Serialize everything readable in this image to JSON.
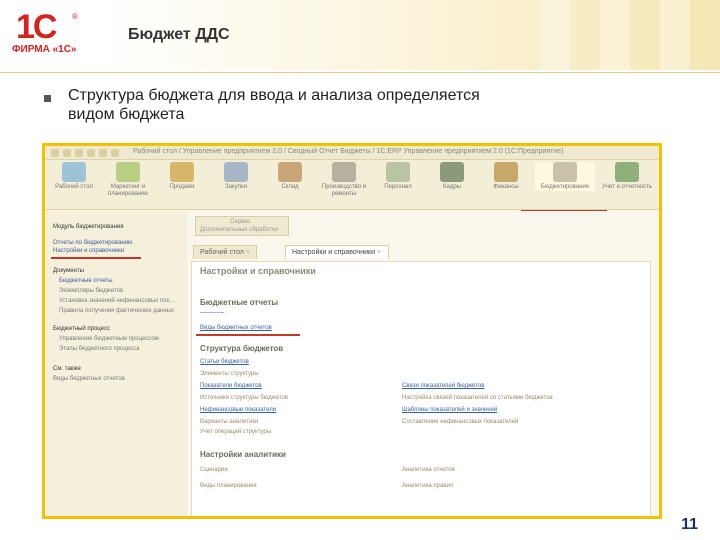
{
  "slide": {
    "logo_mark": "1С",
    "logo_reg": "®",
    "logo_text": "ФИРМА «1С»",
    "title": "Бюджет ДДС",
    "bullet": "Структура бюджета для ввода и анализа определяется видом бюджета",
    "page_number": "11"
  },
  "app": {
    "title": "Рабочий стол / Управление предприятием 2.0 / Сводный Отчет Бюджеты / 1С:ERP Управление предприятием 2.0 (1С:Предприятие)",
    "sections": [
      {
        "label": "Рабочий стол",
        "color": "#9cc3d8"
      },
      {
        "label": "Маркетинг и планирование",
        "color": "#b9cf83"
      },
      {
        "label": "Продажи",
        "color": "#d8b76a"
      },
      {
        "label": "Закупки",
        "color": "#a7b7c8"
      },
      {
        "label": "Склад",
        "color": "#c8a679"
      },
      {
        "label": "Производство и ремонты",
        "color": "#b8b1a0"
      },
      {
        "label": "Персонал",
        "color": "#b9c4a3"
      },
      {
        "label": "Кадры",
        "color": "#8b9b7a"
      },
      {
        "label": "Финансы",
        "color": "#c7a76a"
      },
      {
        "label": "Бюджетирование",
        "color": "#c9c2a9"
      },
      {
        "label": "Учет и отчетность",
        "color": "#8fb07a"
      }
    ],
    "nav": {
      "group1": "Модуль бюджетирования",
      "reports_link": "Отчеты по бюджетированию",
      "settings_link": "Настройки и справочники",
      "group2": "Документы",
      "items": [
        "Бюджетные отчеты",
        "Экземпляры бюджетов",
        "Установка значений нефинансовых пок...",
        "Правила получения фактических данных"
      ],
      "group3": "Бюджетный процесс",
      "process_items": [
        "Управление бюджетным процессом",
        "Этапы бюджетного процесса"
      ],
      "see_also": "См. также",
      "see_also_item": "Виды бюджетных отчетов"
    },
    "tabs": {
      "top_box": "Сервис",
      "top_box_sub": "Дополнительные обработки",
      "home": "Рабочий стол",
      "settings": "Настройки и справочники"
    },
    "panel": {
      "title": "Настройки и справочники",
      "group_reports": "Бюджетные отчеты",
      "report_kinds": "Виды бюджетных отчетов",
      "group_structure": "Структура бюджетов",
      "left_links": [
        "Статьи бюджетов",
        "Элементы структуры",
        "Показатели бюджетов",
        "Источники структуры бюджетов",
        "Нефинансовые показатели",
        "Варианты аналитики",
        "Учет операций структуры"
      ],
      "right_links": [
        "Связи показателей бюджетов",
        "Настройка связей показателей со статьями бюджетов",
        "Шаблоны показателей и значений",
        "Составление нефинансовых показателей"
      ],
      "group_analytics": "Настройки аналитики",
      "analytics_left": [
        "Сценарии",
        "Виды планирования"
      ],
      "analytics_right": [
        "Аналитика отчетов",
        "Аналитика правил"
      ]
    }
  }
}
